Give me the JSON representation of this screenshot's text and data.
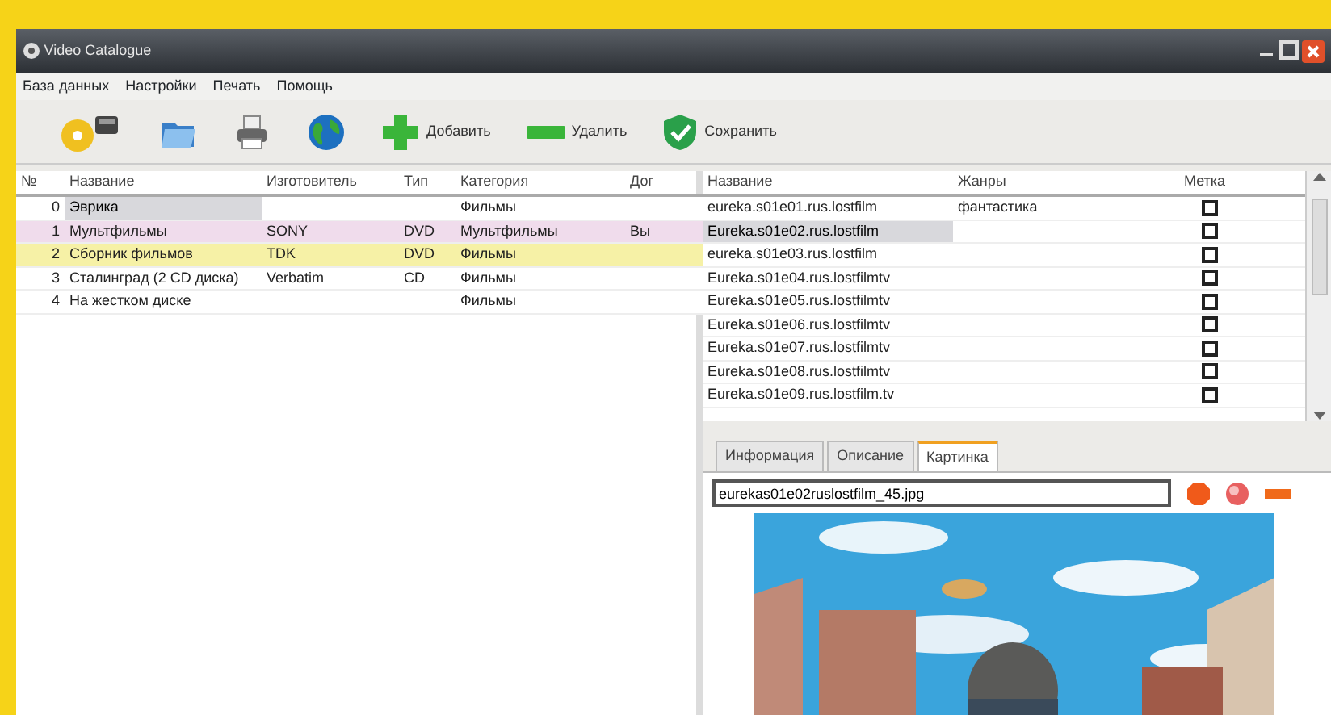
{
  "window": {
    "title": "Video Catalogue"
  },
  "menu": [
    "База данных",
    "Настройки",
    "Печать",
    "Помощь"
  ],
  "toolbar": [
    {
      "kind": "disc"
    },
    {
      "kind": "folder"
    },
    {
      "kind": "printer"
    },
    {
      "kind": "globe"
    },
    {
      "kind": "add",
      "label": "Добавить"
    },
    {
      "kind": "delete",
      "label": "Удалить"
    },
    {
      "kind": "save",
      "label": "Сохранить"
    }
  ],
  "collections": {
    "columns": [
      "№",
      "Название",
      "Изготовитель",
      "Тип",
      "Категория",
      "Дог"
    ],
    "rows": [
      {
        "cells": [
          "0",
          "Эврика",
          "",
          "",
          "Фильмы",
          ""
        ],
        "selected": true,
        "color": "#ffffff"
      },
      {
        "cells": [
          "1",
          "Мультфильмы",
          "SONY",
          "DVD",
          "Мультфильмы",
          "Вы"
        ],
        "selected": false,
        "color": "#f0dcec"
      },
      {
        "cells": [
          "2",
          "Сборник фильмов",
          "TDK",
          "DVD",
          "Фильмы",
          ""
        ],
        "selected": false,
        "color": "#f6f1a6"
      },
      {
        "cells": [
          "3",
          "Сталинград (2 CD диска)",
          "Verbatim",
          "CD",
          "Фильмы",
          ""
        ],
        "selected": false,
        "color": "#ffffff"
      },
      {
        "cells": [
          "4",
          "На жестком диске",
          "",
          "",
          "Фильмы",
          ""
        ],
        "selected": false,
        "color": "#ffffff"
      }
    ]
  },
  "files": {
    "columns": [
      "Название",
      "Жанры",
      "Метка"
    ],
    "rows": [
      {
        "name": "eureka.s01e01.rus.lostfilm",
        "genre": "фантастика",
        "checked": false,
        "selected": false
      },
      {
        "name": "Eureka.s01e02.rus.lostfilm",
        "checked": false,
        "selected": true
      },
      {
        "name": "eureka.s01e03.rus.lostfilm",
        "checked": false,
        "selected": false
      },
      {
        "name": "Eureka.s01e04.rus.lostfilmtv",
        "checked": false,
        "selected": false
      },
      {
        "name": "Eureka.s01e05.rus.lostfilmtv",
        "checked": false,
        "selected": false
      },
      {
        "name": "Eureka.s01e06.rus.lostfilmtv",
        "checked": false,
        "selected": false
      },
      {
        "name": "Eureka.s01e07.rus.lostfilmtv",
        "checked": false,
        "selected": false
      },
      {
        "name": "Eureka.s01e08.rus.lostfilmtv",
        "checked": false,
        "selected": false
      },
      {
        "name": "Eureka.s01e09.rus.lostfilm.tv",
        "checked": false,
        "selected": false
      }
    ]
  },
  "tabs": [
    {
      "label": "Информация",
      "selected": false
    },
    {
      "label": "Описание",
      "selected": false
    },
    {
      "label": "Картинка",
      "selected": true
    }
  ],
  "image_file": {
    "value": "eurekas01e02ruslostfilm_45.jpg"
  },
  "image_buttons": [
    {
      "kind": "stop"
    },
    {
      "kind": "ball"
    },
    {
      "kind": "minus"
    }
  ],
  "preview": {
    "kind": "picture"
  }
}
